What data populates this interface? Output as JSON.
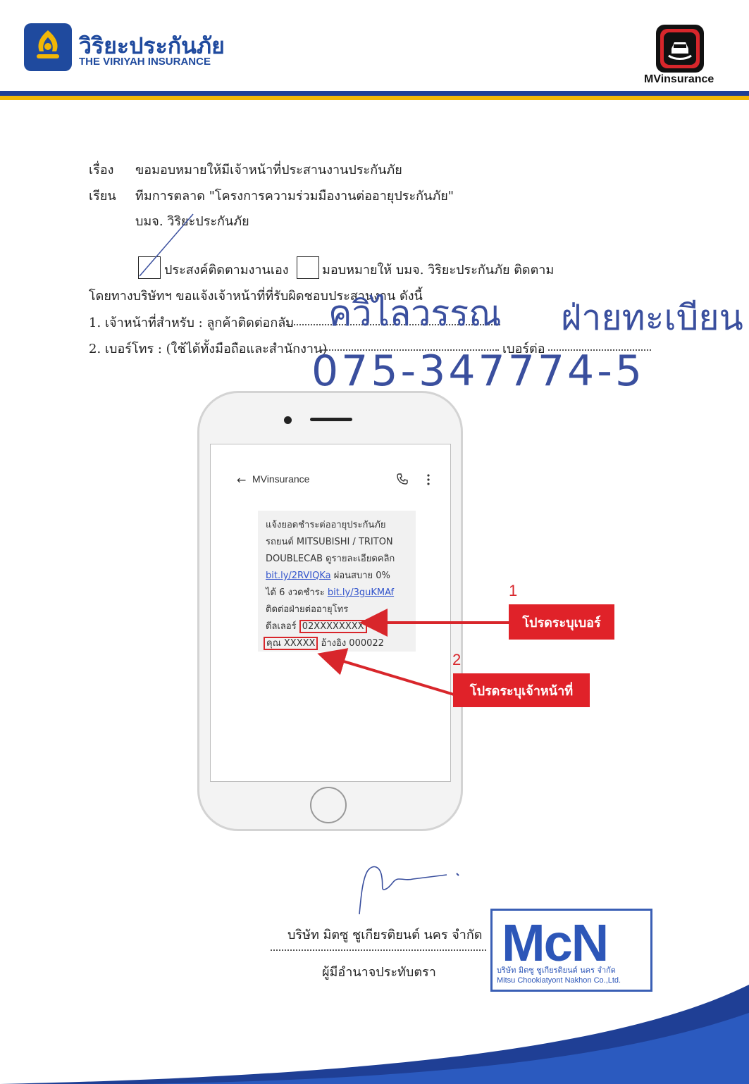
{
  "header": {
    "brand_th": "วิริยะประกันภัย",
    "brand_en": "THE VIRIYAH INSURANCE",
    "app_logo_text": "MVinsurance",
    "colors": {
      "brand_blue": "#1f4a9e",
      "band_gold": "#f2b705",
      "accent_red": "#e02229"
    }
  },
  "letter": {
    "subject_label": "เรื่อง",
    "subject": "ขอมอบหมายให้มีเจ้าหน้าที่ประสานงานประกันภัย",
    "to_label": "เรียน",
    "to_line1": "ทีมการตลาด \"โครงการความร่วมมืองานต่ออายุประกันภัย\"",
    "to_line2": "บมจ. วิริยะประกันภัย",
    "option_self": "ประสงค์ติดตามงานเอง",
    "option_assign": "มอบหมายให้ บมจ. วิริยะประกันภัย ติดตาม",
    "intro": "โดยทางบริษัทฯ ขอแจ้งเจ้าหน้าที่ที่รับผิดชอบประสานงาน ดังนี้",
    "item1": "1. เจ้าหน้าที่สำหรับ : ลูกค้าติดต่อกลับ",
    "item2": "2. เบอร์โทร : (ใช้ได้ทั้งมือถือและสำนักงาน)",
    "ext_label": "เบอร์ต่อ"
  },
  "handwriting": {
    "staff_name": "ควิไลวรรณ",
    "department": "ฝ่ายทะเบียน",
    "phone": "075-347774-5"
  },
  "phone_mockup": {
    "app_title": "MVinsurance",
    "sms_lines": [
      "แจ้งยอดชำระต่ออายุประกันภัย",
      "รถยนต์ MITSUBISHI / TRITON",
      "DOUBLECAB ดูรายละเอียดคลิก"
    ],
    "link1": "bit.ly/2RVIQKa",
    "link1_suffix": " ผ่อนสบาย 0%",
    "line5_prefix": "ได้ 6 งวดชำระ ",
    "link2": "bit.ly/3guKMAf",
    "line6": "ติดต่อฝ่ายต่ออายุโทร",
    "dealer_prefix": "ดีลเลอร์ ",
    "dealer_number": "02XXXXXXXX",
    "customer_name": "คุณ XXXXX",
    "reference": " อ้างอิง 000022"
  },
  "callouts": [
    {
      "number": "1",
      "label": "โปรดระบุเบอร์"
    },
    {
      "number": "2",
      "label": "โปรดระบุเจ้าหน้าที่"
    }
  ],
  "signature": {
    "company": "บริษัท มิตซู ชูเกียรติยนต์ นคร จำกัด",
    "role": "ผู้มีอำนาจประทับตรา",
    "stamp_logo": "McN",
    "stamp_th": "บริษัท มิตซู ชูเกียรติยนต์ นคร จำกัด",
    "stamp_en": "Mitsu Chookiatyont Nakhon Co.,Ltd."
  }
}
